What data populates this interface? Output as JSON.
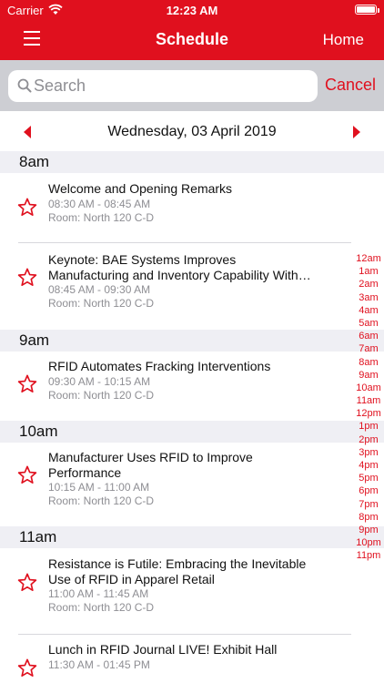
{
  "status_bar": {
    "carrier": "Carrier",
    "time": "12:23 AM"
  },
  "nav": {
    "title": "Schedule",
    "home_label": "Home"
  },
  "search": {
    "placeholder": "Search",
    "cancel_label": "Cancel"
  },
  "date_bar": {
    "date": "Wednesday, 03 April 2019"
  },
  "hours": [
    {
      "label": "8am"
    },
    {
      "label": "9am"
    },
    {
      "label": "10am"
    },
    {
      "label": "11am"
    }
  ],
  "sessions": [
    {
      "title": "Welcome and Opening Remarks",
      "time": "08:30 AM - 08:45 AM",
      "room": "Room: North 120 C-D"
    },
    {
      "title": "Keynote: BAE Systems Improves",
      "title2": "Manufacturing and Inventory Capability With…",
      "time": "08:45 AM - 09:30 AM",
      "room": "Room: North 120 C-D"
    },
    {
      "title": "RFID Automates Fracking Interventions",
      "time": "09:30 AM - 10:15 AM",
      "room": "Room: North 120 C-D"
    },
    {
      "title": "Manufacturer Uses RFID to Improve",
      "title2": "Performance",
      "time": "10:15 AM - 11:00 AM",
      "room": "Room: North 120 C-D"
    },
    {
      "title": "Resistance is Futile: Embracing the Inevitable",
      "title2": "Use of RFID in Apparel Retail",
      "time": "11:00 AM - 11:45 AM",
      "room": "Room: North 120 C-D"
    },
    {
      "title": "Lunch in RFID Journal LIVE! Exhibit Hall",
      "time": "11:30 AM - 01:45 PM",
      "room": ""
    }
  ],
  "hour_index": [
    "12am",
    "1am",
    "2am",
    "3am",
    "4am",
    "5am",
    "6am",
    "7am",
    "8am",
    "9am",
    "10am",
    "11am",
    "12pm",
    "1pm",
    "2pm",
    "3pm",
    "4pm",
    "5pm",
    "6pm",
    "7pm",
    "8pm",
    "9pm",
    "10pm",
    "11pm"
  ],
  "colors": {
    "accent": "#e0101e",
    "section_bg": "#efeff4",
    "search_bg": "#cdced3",
    "secondary_text": "#8e8e93"
  },
  "icons": {
    "menu": "hamburger-icon",
    "search": "search-icon",
    "favorite": "star-outline-icon",
    "prev": "caret-left-icon",
    "next": "caret-right-icon"
  }
}
